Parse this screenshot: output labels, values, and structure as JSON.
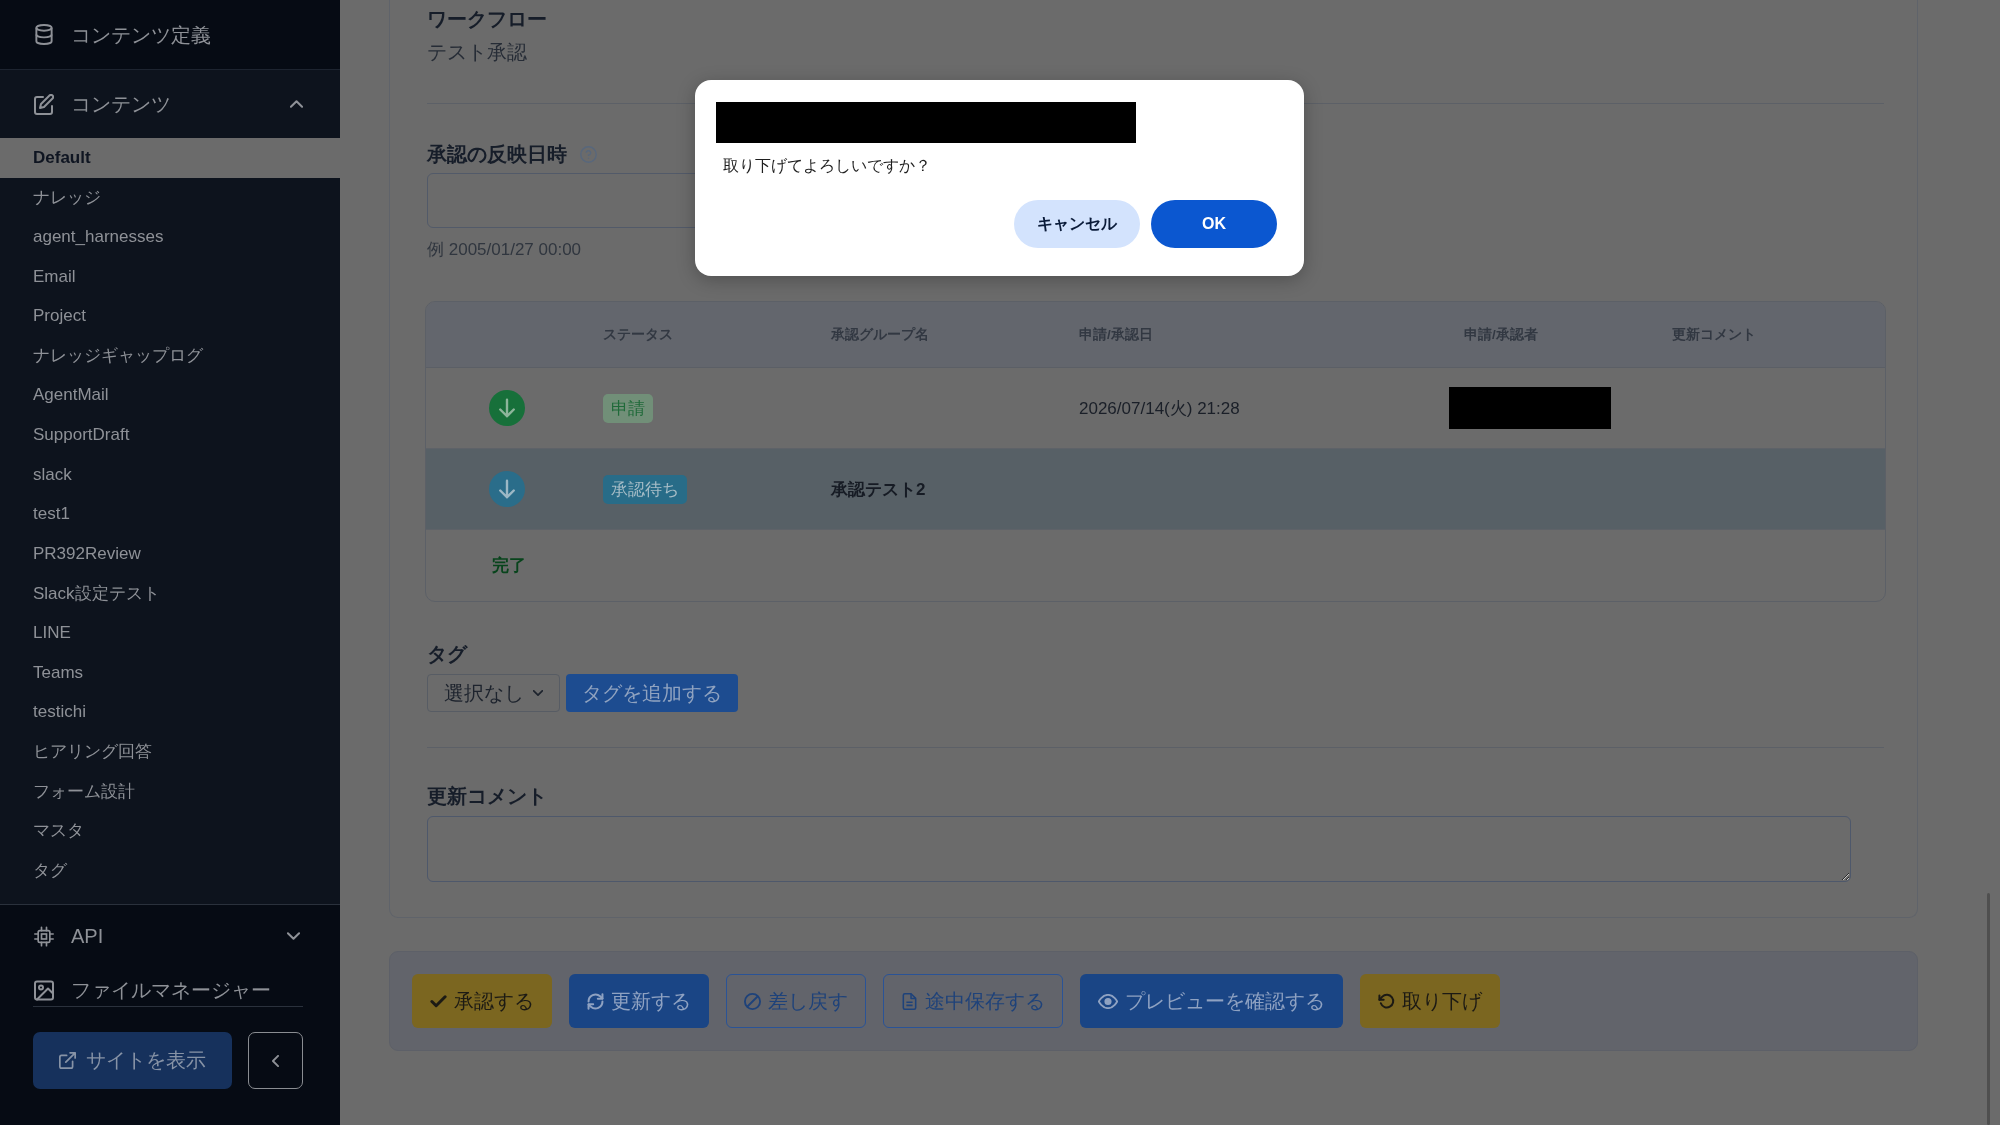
{
  "sidebar": {
    "content_definitions": "コンテンツ定義",
    "contents": {
      "label": "コンテンツ",
      "expanded": true,
      "items": [
        {
          "label": "Default",
          "selected": true
        },
        {
          "label": "ナレッジ",
          "selected": false
        },
        {
          "label": "agent_harnesses",
          "selected": false
        },
        {
          "label": "Email",
          "selected": false
        },
        {
          "label": "Project",
          "selected": false
        },
        {
          "label": "ナレッジギャップログ",
          "selected": false
        },
        {
          "label": "AgentMail",
          "selected": false
        },
        {
          "label": "SupportDraft",
          "selected": false
        },
        {
          "label": "slack",
          "selected": false
        },
        {
          "label": "test1",
          "selected": false
        },
        {
          "label": "PR392Review",
          "selected": false
        },
        {
          "label": "Slack設定テスト",
          "selected": false
        },
        {
          "label": "LINE",
          "selected": false
        },
        {
          "label": "Teams",
          "selected": false
        },
        {
          "label": "testichi",
          "selected": false
        },
        {
          "label": "ヒアリング回答",
          "selected": false
        },
        {
          "label": "フォーム設計",
          "selected": false
        },
        {
          "label": "マスタ",
          "selected": false
        },
        {
          "label": "タグ",
          "selected": false
        }
      ]
    },
    "api": {
      "label": "API",
      "expanded": false
    },
    "file_manager": "ファイルマネージャー",
    "view_site": "サイトを表示"
  },
  "form": {
    "workflow": {
      "label": "ワークフロー",
      "value": "テスト承認"
    },
    "publish_datetime": {
      "label": "承認の反映日時",
      "hint": "例 2005/01/27 00:00"
    },
    "approval_steps": {
      "columns": [
        "ステータス",
        "承認グループ名",
        "申請/承認日",
        "申請/承認者",
        "更新コメント"
      ],
      "rows": [
        {
          "kind": "applied",
          "status": "申請",
          "date": "2026/07/14(火) 21:28",
          "applicant_redacted": true,
          "current": false
        },
        {
          "kind": "pending",
          "status": "承認待ち",
          "group": "承認テスト2",
          "applicant_redacted": false,
          "current": true
        }
      ],
      "end_label": "完了"
    },
    "tags": {
      "label": "タグ",
      "select_value": "選択なし",
      "add_button": "タグを追加する"
    },
    "update_comment": {
      "label": "更新コメント"
    }
  },
  "actions": [
    {
      "kind": "approve",
      "label": "承認する"
    },
    {
      "kind": "update",
      "label": "更新する"
    },
    {
      "kind": "send_back",
      "label": "差し戻す"
    },
    {
      "kind": "save_draft",
      "label": "途中保存する"
    },
    {
      "kind": "preview",
      "label": "プレビューを確認する"
    },
    {
      "kind": "withdraw",
      "label": "取り下げ"
    }
  ],
  "dialog": {
    "title_redacted": true,
    "message": "取り下げてよろしいですか？",
    "buttons": [
      {
        "kind": "cancel",
        "label": "キャンセル"
      },
      {
        "kind": "ok",
        "label": "OK"
      }
    ]
  }
}
